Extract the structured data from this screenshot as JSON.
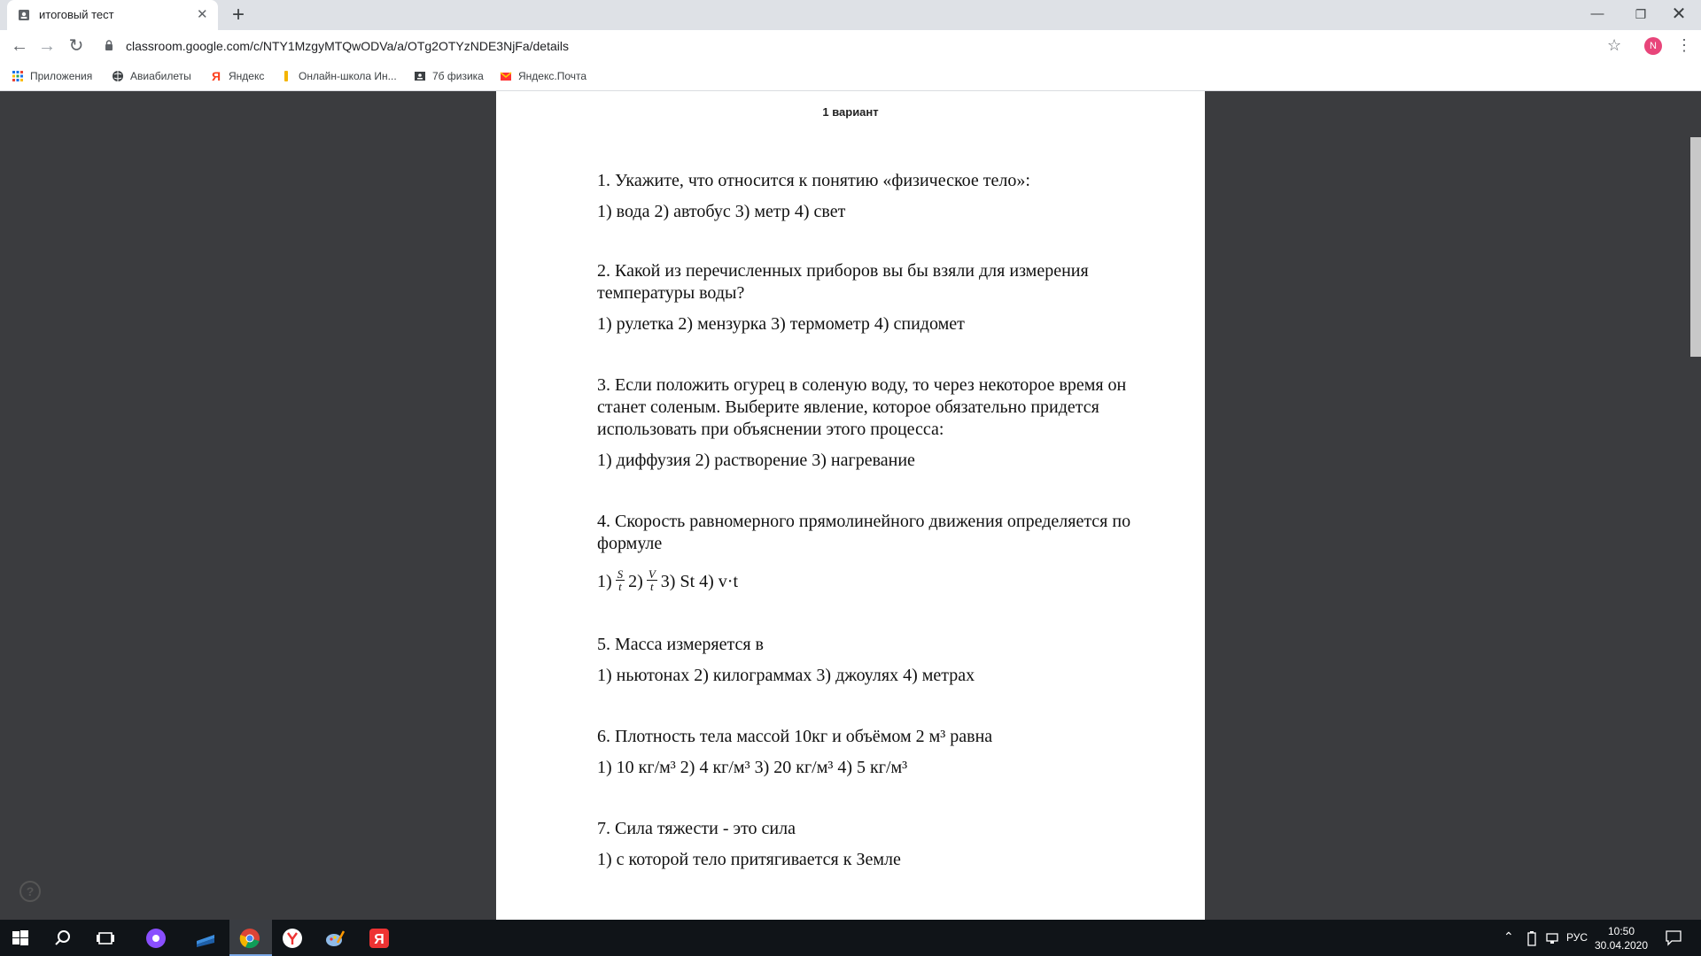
{
  "browser": {
    "tab_title": "итоговый тест",
    "url": "classroom.google.com/c/NTY1MzgyMTQwODVa/a/OTg2OTYzNDE3NjFa/details",
    "profile_initial": "N"
  },
  "bookmarks": [
    {
      "label": "Приложения",
      "icon": "apps-grid-icon"
    },
    {
      "label": "Авиабилеты",
      "icon": "globe-icon"
    },
    {
      "label": "Яндекс",
      "icon": "yandex-icon"
    },
    {
      "label": "Онлайн-школа Ин...",
      "icon": "bookmark-icon"
    },
    {
      "label": "7б физика",
      "icon": "classroom-icon"
    },
    {
      "label": "Яндекс.Почта",
      "icon": "mail-icon"
    }
  ],
  "document": {
    "heading": "1 вариант",
    "questions": [
      {
        "text": "1. Укажите, что относится к понятию «физическое тело»:",
        "answers": "1) вода 2) автобус 3) метр 4) свет"
      },
      {
        "text": "2. Какой из перечисленных приборов вы бы взяли для измерения температуры воды?",
        "answers": "1) рулетка 2) мензурка 3) термометр 4) спидомет"
      },
      {
        "text": "3. Если положить огурец в соленую воду, то через некоторое время он станет соленым. Выберите явление, которое обязательно придется использовать при объяснении этого процесса:",
        "answers": "1) диффузия 2) растворение 3) нагревание"
      },
      {
        "text": "4. Скорость равномерного прямолинейного движения определяется по формуле",
        "answer_parts": {
          "p1": "1)",
          "f1_num": "S",
          "f1_den": "t",
          "p2": "2)",
          "f2_num": "V",
          "f2_den": "t",
          "p3": "3) St 4) v·t"
        }
      },
      {
        "text": "5. Масса измеряется в",
        "answers": "1) ньютонах 2) килограммах 3) джоулях 4) метрах"
      },
      {
        "text": "6. Плотность тела массой 10кг и объёмом 2 м³ равна",
        "answers": "1) 10 кг/м³ 2) 4 кг/м³ 3) 20 кг/м³ 4) 5 кг/м³"
      },
      {
        "text": "7. Сила тяжести - это сила",
        "answers": "1) с которой тело притягивается к Земле"
      }
    ]
  },
  "taskbar": {
    "language": "РУС",
    "time": "10:50",
    "date": "30.04.2020"
  },
  "colors": {
    "overlay": "#202124",
    "profile": "#e8457a"
  }
}
